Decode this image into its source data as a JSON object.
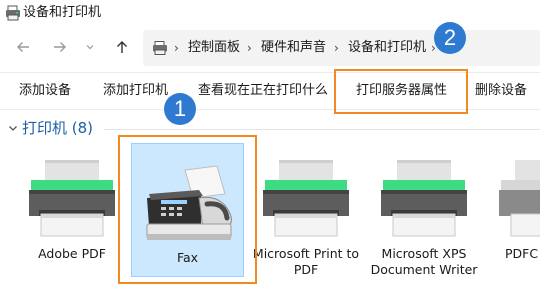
{
  "window": {
    "title": "设备和打印机"
  },
  "address": {
    "crumbs": [
      "控制面板",
      "硬件和声音",
      "设备和打印机"
    ]
  },
  "toolbar": {
    "add_device": "添加设备",
    "add_printer": "添加打印机",
    "see_printing": "查看现在正在打印什么",
    "print_server_props": "打印服务器属性",
    "remove_device": "删除设备"
  },
  "group": {
    "title": "打印机 (8)"
  },
  "devices": [
    {
      "label": "Adobe PDF",
      "icon": "printer-icon"
    },
    {
      "label": "Fax",
      "icon": "fax-icon"
    },
    {
      "label": "Microsoft Print to PDF",
      "icon": "printer-icon"
    },
    {
      "label": "Microsoft XPS Document Writer",
      "icon": "printer-icon"
    },
    {
      "label": "PDFC",
      "icon": "printer-icon"
    }
  ],
  "annotations": {
    "badge_1": "1",
    "badge_2": "2"
  },
  "colors": {
    "highlight": "#f08a24",
    "badge": "#2e7ad0",
    "selection": "#cce8ff",
    "group_title": "#1f5fa8"
  }
}
